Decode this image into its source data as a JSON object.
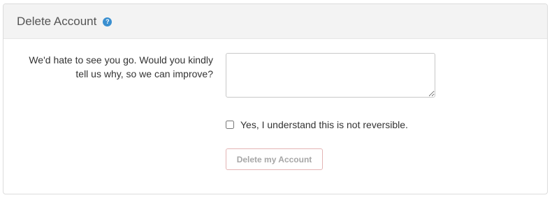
{
  "panel": {
    "title": "Delete Account",
    "help_icon": "help-question-icon",
    "help_glyph": "?"
  },
  "form": {
    "prompt": "We'd hate to see you go. Would you kindly tell us why, so we can improve?",
    "reason_value": "",
    "reason_placeholder": "",
    "confirm_checked": false,
    "confirm_label": "Yes, I understand this is not reversible.",
    "delete_button_label": "Delete my Account"
  },
  "colors": {
    "header_bg": "#f3f3f3",
    "help_icon": "#3a8fd0",
    "button_border": "#e4b4b4",
    "button_text_disabled": "#a6a6a6"
  }
}
